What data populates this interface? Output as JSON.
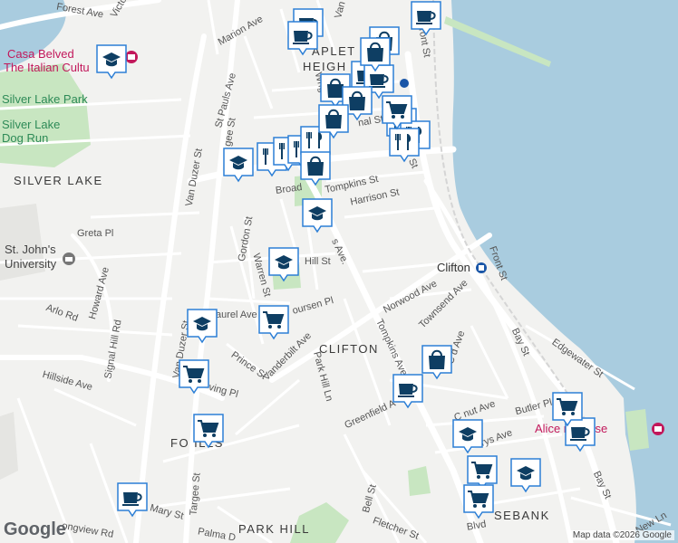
{
  "neighborhoods": {
    "silver_lake": "SILVER LAKE",
    "clifton": "CLIFTON",
    "park_hill": "PARK HILL",
    "fox_hills": "FO  ILLS",
    "stapleton_heights": "APLET",
    "heights2": "HEIGH",
    "rosebank": "SEBANK"
  },
  "places": {
    "casa_belvedere_1": "Casa Belved",
    "casa_belvedere_2": "The Italian Cultu",
    "silver_lake_park": "Silver Lake Park",
    "silver_lake_dog_1": "Silver Lake",
    "silver_lake_dog_2": "Dog Run",
    "st_johns_1": "St. John's",
    "st_johns_2": "University",
    "clifton_station": "Clifton",
    "alice_austen": "Alice     n House"
  },
  "streets": {
    "forest_ave": "Forest Ave",
    "victory": "Victo",
    "marion_ave": "Marion Ave",
    "howard_ave": "Howard Ave",
    "st_pauls_ave": "St Pauls Ave",
    "van_duzer_st": "Van Duzer St",
    "targee_st_top": "gee St",
    "greta_pl": "Greta Pl",
    "gordon_st": "Gordon St",
    "warren_st": "Warren St",
    "hill_st": "Hill St",
    "tompkins_ave_top": "s Ave.",
    "tompkins_st": "Tompkins St",
    "harrison_st": "Harrison St",
    "broad": "Broad",
    "arlo_rd": "Arlo Rd",
    "signal_hill_rd": "Signal Hill Rd",
    "van_duzer_lower": "Van Duzer St",
    "laurel_ave": "aurel Ave",
    "boursen_pl": "oursen Pl",
    "vanderbilt_ave": "Vanderbilt Ave",
    "hillside_ave": "Hillside Ave",
    "prince_st": "Prince St",
    "irving_pl": "ving Pl",
    "park_hill_ln": "Park Hill Ln",
    "norwood_ave": "Norwood Ave",
    "townsend_ave": "Townsend Ave",
    "tompkins_ave": "Tompkins Ave",
    "greenfield_ave": "Greenfield A",
    "bay_st": "Bay St",
    "bay_st_lower": "Bay St",
    "bay_st_top": "ay St",
    "front_st": "Front St",
    "front_st_top": "Front St",
    "edgewater_st": "Edgewater St",
    "chestnut_ave": "C   nut Ave",
    "butler_pl": "Butler Pl",
    "mary_ave": "   rys Ave",
    "cd_ave": "C    d Ave",
    "wright": "Wrigh",
    "canal_st": "nal St",
    "van_top": "Van",
    "targee_st": "Targee St",
    "mary_st": "Mary St",
    "longview_rd": "ongview Rd",
    "palma_dr": "Palma D",
    "bell_st": "Bell St",
    "fletcher_st": "Fletcher St",
    "blvd": "Blvd",
    "new_ln": "New Ln"
  },
  "attribution": {
    "logo": "Google",
    "text": "Map data ©2026 Google"
  },
  "icons": {
    "school": "school-icon",
    "restaurant": "restaurant-icon",
    "cafe": "cafe-icon",
    "shopping_bag": "shopping-bag-icon",
    "grocery": "grocery-cart-icon"
  },
  "colors": {
    "water": "#a9ccdf",
    "park": "#c8e6c1",
    "road": "#ffffff",
    "land": "#f2f2f0",
    "pin_fill": "#ffffff",
    "pin_border": "#2c7fd6",
    "icon": "#0e3e63"
  }
}
